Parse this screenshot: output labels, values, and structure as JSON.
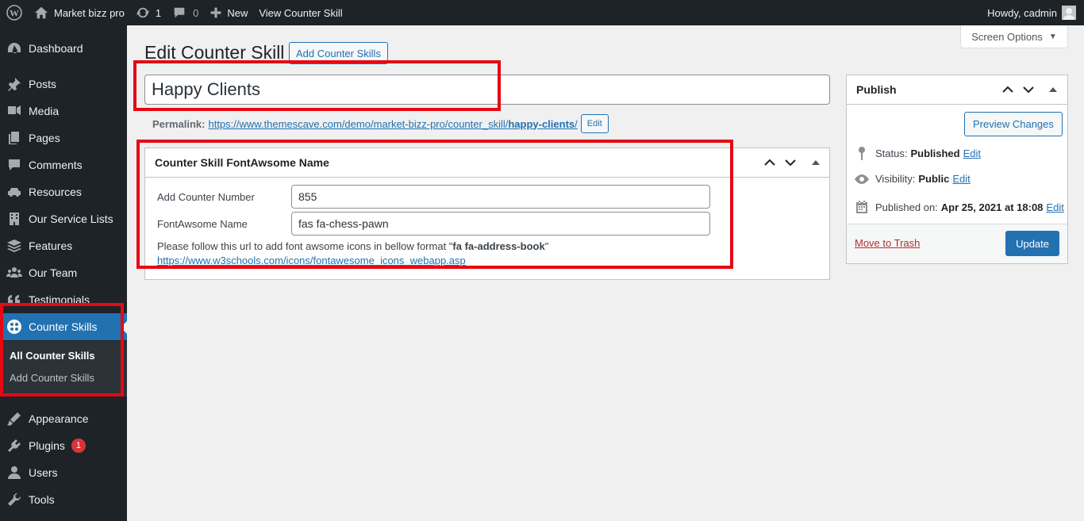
{
  "adminbar": {
    "site_name": "Market bizz pro",
    "updates_count": "1",
    "comments_count": "0",
    "new_label": "New",
    "view_label": "View Counter Skill",
    "howdy": "Howdy, cadmin"
  },
  "sidebar": {
    "items": [
      {
        "label": "Dashboard",
        "icon": "dashboard-icon"
      },
      {
        "label": "Posts",
        "icon": "pin-icon"
      },
      {
        "label": "Media",
        "icon": "media-icon"
      },
      {
        "label": "Pages",
        "icon": "pages-icon"
      },
      {
        "label": "Comments",
        "icon": "comment-icon"
      },
      {
        "label": "Resources",
        "icon": "car-icon"
      },
      {
        "label": "Our Service Lists",
        "icon": "building-icon"
      },
      {
        "label": "Features",
        "icon": "stack-icon"
      },
      {
        "label": "Our Team",
        "icon": "groups-icon"
      },
      {
        "label": "Testimonials",
        "icon": "quote-icon"
      },
      {
        "label": "Counter Skills",
        "icon": "counter-icon"
      },
      {
        "label": "Appearance",
        "icon": "brush-icon"
      },
      {
        "label": "Plugins",
        "icon": "plugin-icon",
        "badge": "1"
      },
      {
        "label": "Users",
        "icon": "user-icon"
      },
      {
        "label": "Tools",
        "icon": "wrench-icon"
      }
    ],
    "submenu": {
      "all": "All Counter Skills",
      "add": "Add Counter Skills"
    }
  },
  "screen_options": "Screen Options",
  "page": {
    "title": "Edit Counter Skill",
    "add_new": "Add Counter Skills",
    "post_title": "Happy Clients",
    "permalink_label": "Permalink:",
    "permalink_base": "https://www.themescave.com/demo/market-bizz-pro/counter_skill/",
    "permalink_slug": "happy-clients",
    "permalink_tail": "/",
    "permalink_edit": "Edit"
  },
  "metabox": {
    "title": "Counter Skill FontAwsome Name",
    "number_label": "Add Counter Number",
    "number_value": "855",
    "fa_label": "FontAwsome Name",
    "fa_value": "fas fa-chess-pawn",
    "help_prefix": "Please follow this url to add font awsome icons in bellow format \"",
    "help_code": "fa fa-address-book",
    "help_suffix": "\"",
    "help_url": "https://www.w3schools.com/icons/fontawesome_icons_webapp.asp"
  },
  "publish": {
    "title": "Publish",
    "preview": "Preview Changes",
    "status_label": "Status:",
    "status_value": "Published",
    "visibility_label": "Visibility:",
    "visibility_value": "Public",
    "published_label": "Published on:",
    "published_value": "Apr 25, 2021 at 18:08",
    "edit": "Edit",
    "trash": "Move to Trash",
    "update": "Update"
  },
  "colors": {
    "admin_dark": "#1d2327",
    "accent": "#2271b1",
    "highlight_red": "#e50914",
    "badge_red": "#d63638"
  }
}
